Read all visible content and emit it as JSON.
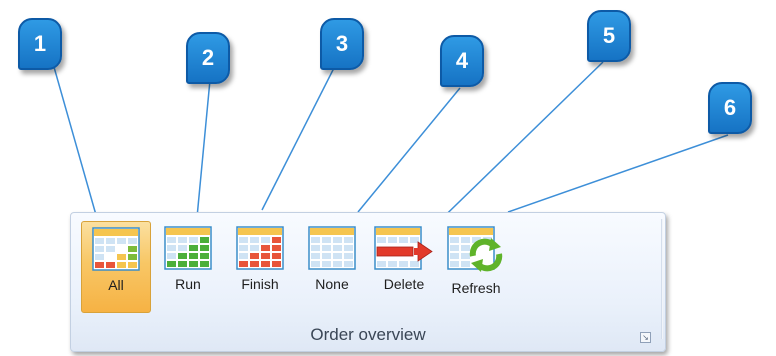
{
  "callouts": [
    {
      "label": "1"
    },
    {
      "label": "2"
    },
    {
      "label": "3"
    },
    {
      "label": "4"
    },
    {
      "label": "5"
    },
    {
      "label": "6"
    }
  ],
  "ribbon": {
    "group_label": "Order overview",
    "launcher_icon": "dialog-launcher-icon",
    "buttons": [
      {
        "label": "All",
        "icon": "grid-all-icon",
        "selected": true
      },
      {
        "label": "Run",
        "icon": "grid-run-icon",
        "selected": false
      },
      {
        "label": "Finish",
        "icon": "grid-finish-icon",
        "selected": false
      },
      {
        "label": "None",
        "icon": "grid-none-icon",
        "selected": false
      },
      {
        "label": "Delete",
        "icon": "grid-delete-icon",
        "selected": false
      },
      {
        "label": "Refresh",
        "icon": "grid-refresh-icon",
        "selected": false
      }
    ]
  },
  "colors": {
    "callout_fill": "#1f86d6",
    "selected_button": "#f8c766",
    "grid_header": "#f5c54f",
    "run_cells": "#4caf3a",
    "finish_cells": "#e8553a",
    "mixed_cells_green": "#7dbb3a"
  }
}
